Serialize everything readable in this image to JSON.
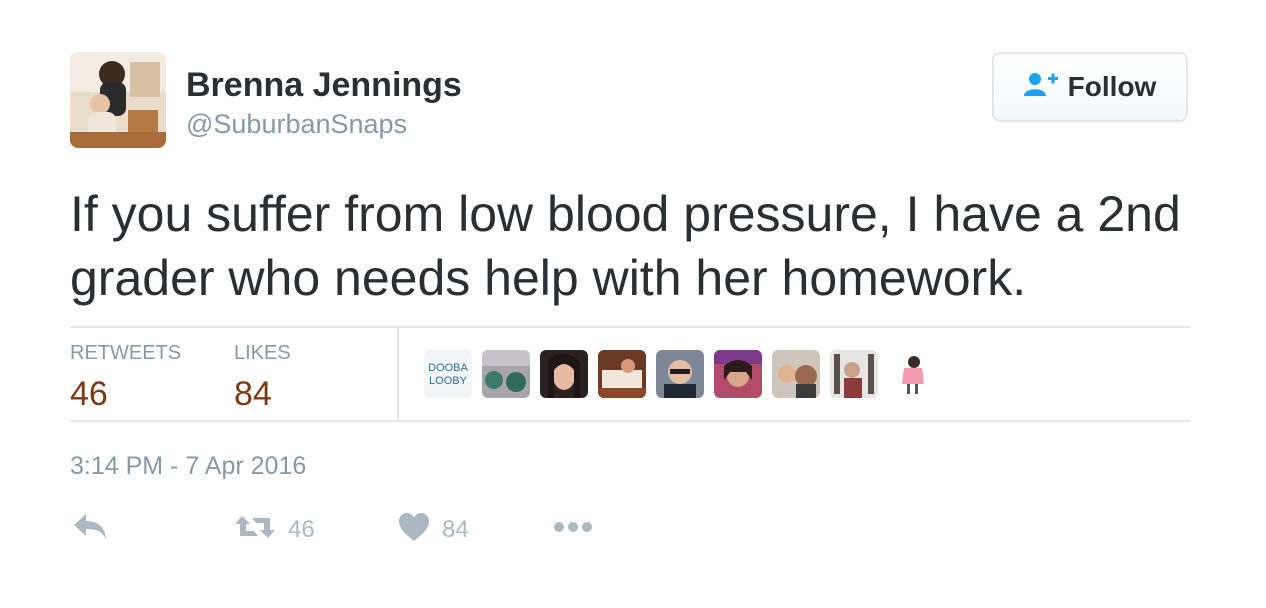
{
  "user": {
    "name": "Brenna Jennings",
    "handle": "@SuburbanSnaps"
  },
  "follow_button": {
    "label": "Follow",
    "icon": "add-user-icon"
  },
  "tweet": {
    "text": "If you suffer from low blood pressure, I have a 2nd grader who needs help with her homework."
  },
  "stats": {
    "retweets_label": "RETWEETS",
    "retweets_value": "46",
    "likes_label": "LIKES",
    "likes_value": "84"
  },
  "likers": [
    {
      "name": "doobaloobay-avatar",
      "text_line1": "DOOBA",
      "text_line2": "LOOBY"
    },
    {
      "name": "liker-avatar-2"
    },
    {
      "name": "liker-avatar-3"
    },
    {
      "name": "liker-avatar-4"
    },
    {
      "name": "liker-avatar-5"
    },
    {
      "name": "liker-avatar-6"
    },
    {
      "name": "liker-avatar-7"
    },
    {
      "name": "liker-avatar-8"
    },
    {
      "name": "liker-avatar-9"
    }
  ],
  "timestamp": "3:14 PM - 7 Apr 2016",
  "actions": {
    "reply_icon": "reply-icon",
    "retweet_icon": "retweet-icon",
    "retweet_count": "46",
    "like_icon": "heart-icon",
    "like_count": "84",
    "more_icon": "more-icon"
  },
  "colors": {
    "count_accent": "#7b3a13",
    "muted": "#8899a6",
    "follow_icon": "#1da1f2"
  }
}
